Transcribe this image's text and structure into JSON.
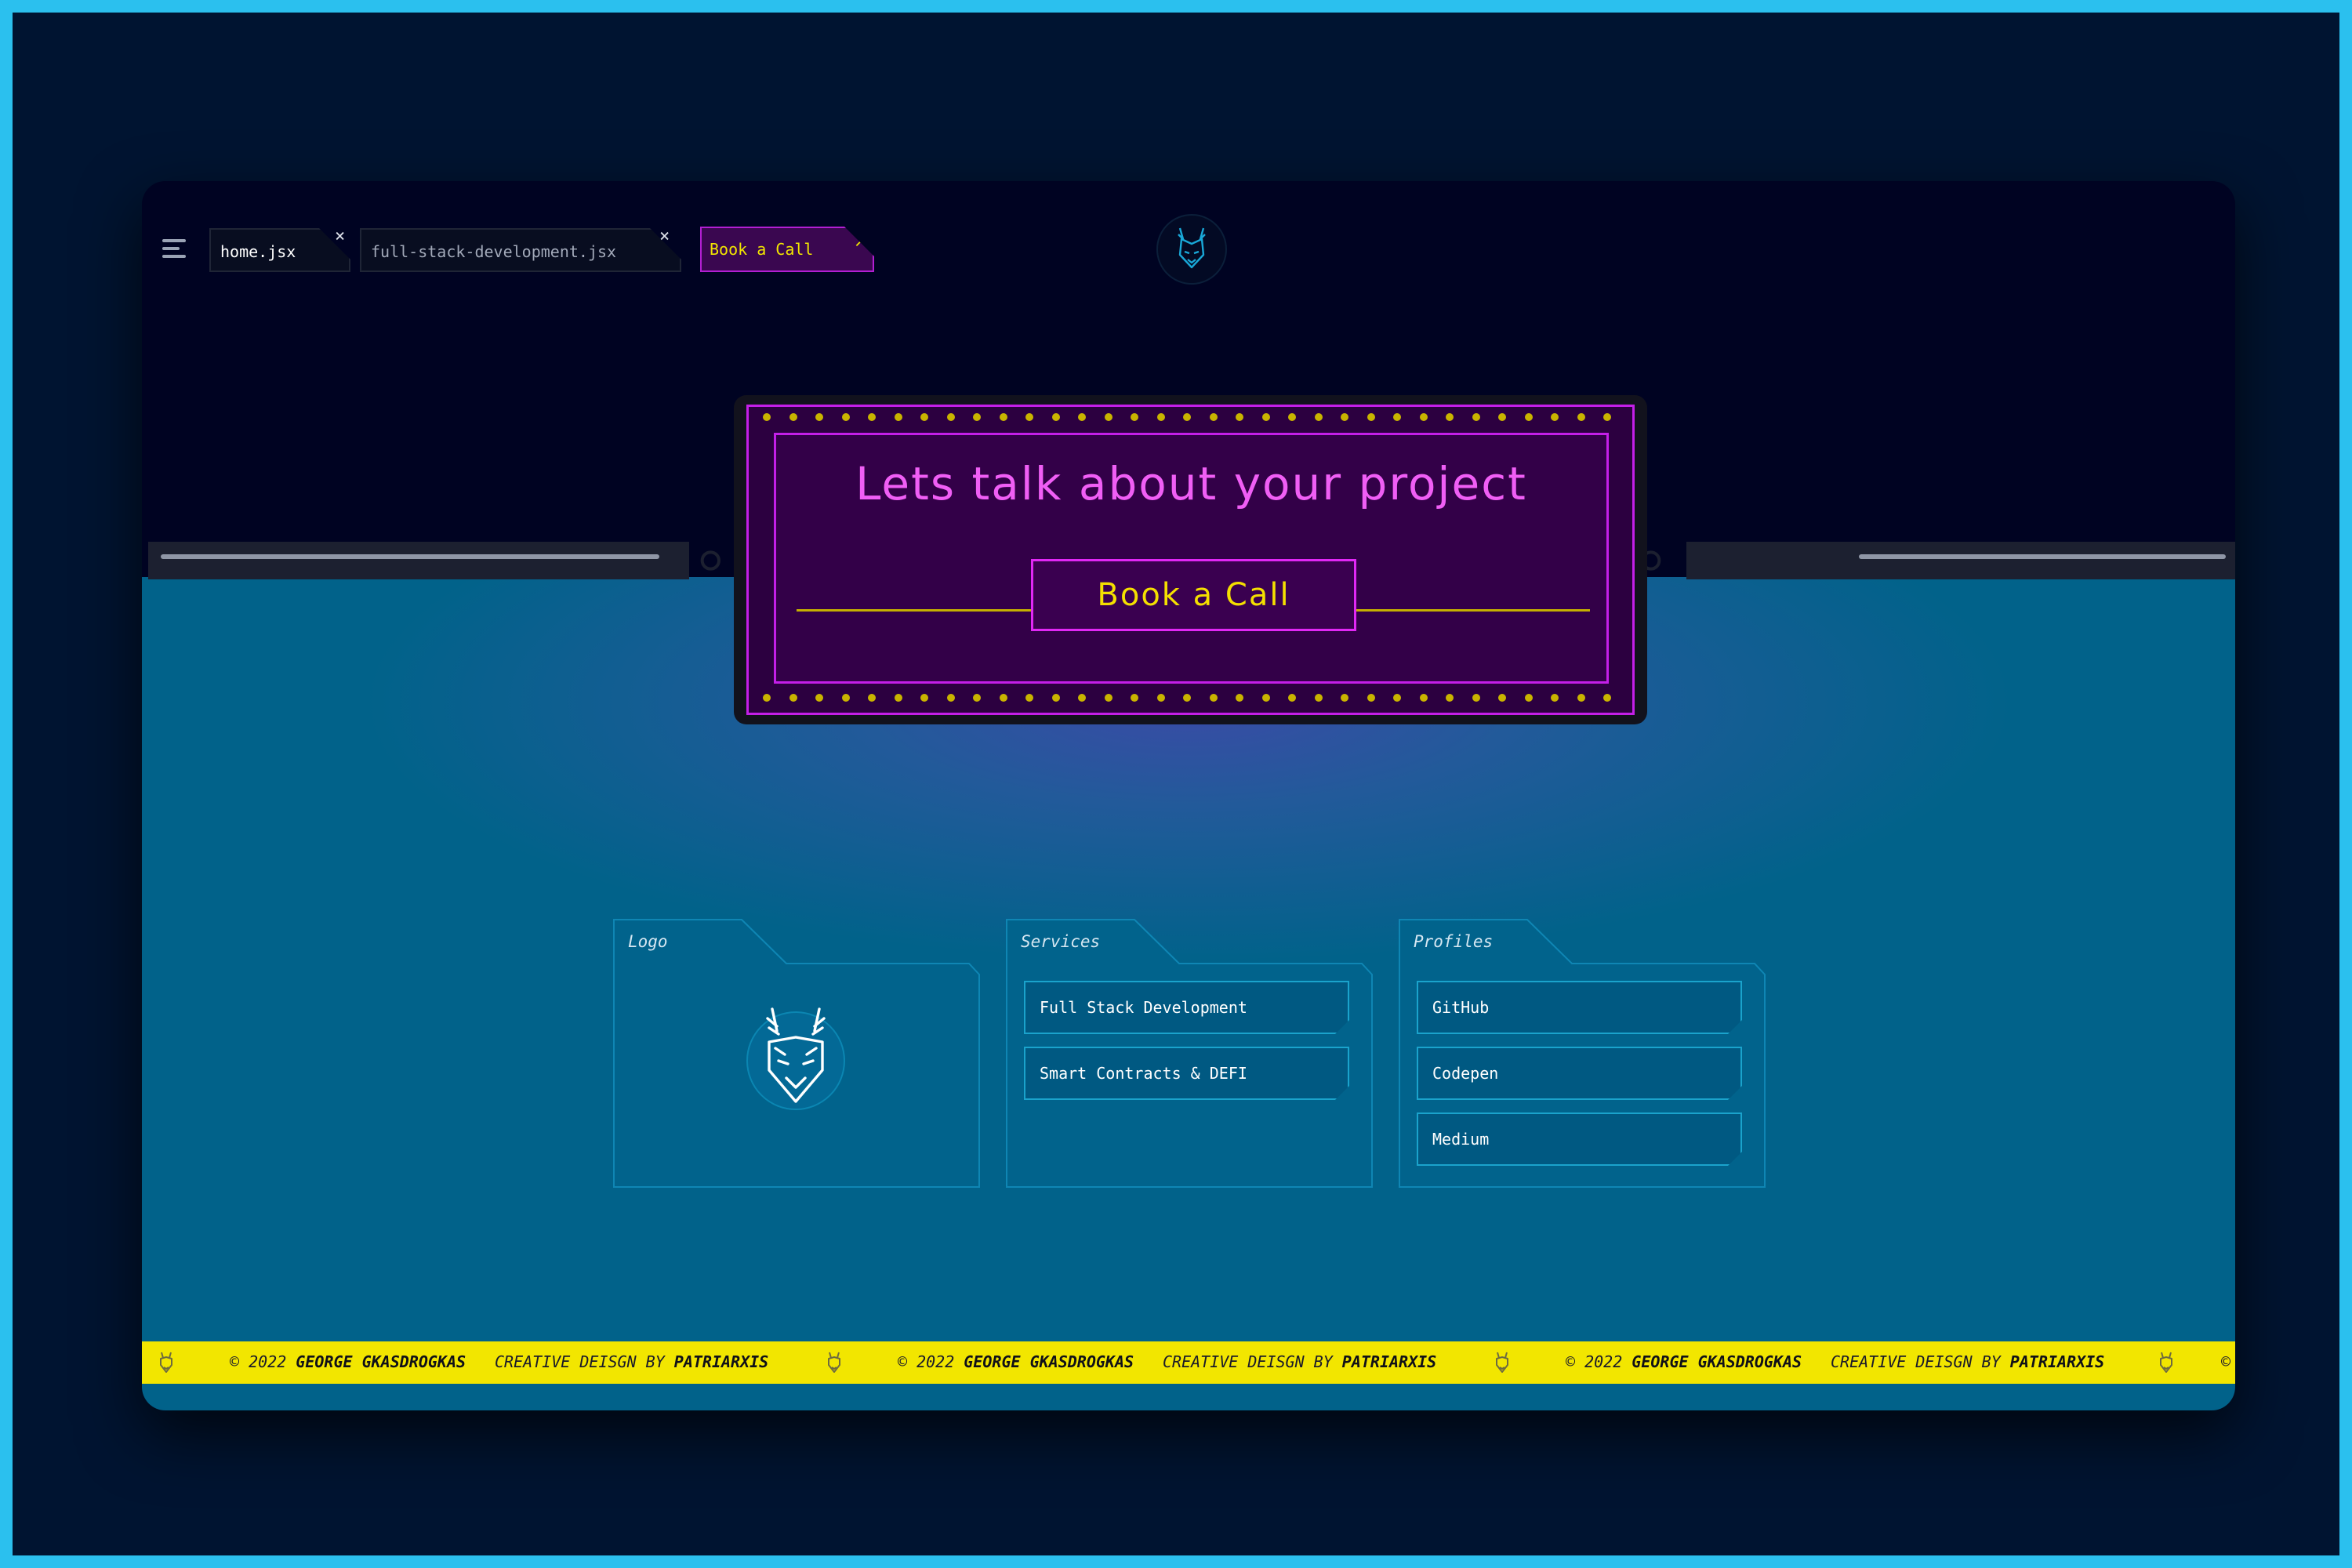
{
  "tabs": [
    {
      "label": "home.jsx",
      "close": "×"
    },
    {
      "label": "full-stack-development.jsx",
      "close": "×"
    }
  ],
  "header": {
    "call_chip_label": "Book a Call",
    "call_chip_icon": "arrow-up-right-icon",
    "menu_icon": "menu-icon",
    "logo_icon": "fox-logo-icon"
  },
  "billboard": {
    "title": "Lets talk about your project",
    "button_label": "Book a Call"
  },
  "folders": {
    "logo": {
      "title": "Logo"
    },
    "services": {
      "title": "Services",
      "items": [
        "Full Stack Development",
        "Smart Contracts & DEFI"
      ]
    },
    "profiles": {
      "title": "Profiles",
      "items": [
        "GitHub",
        "Codepen",
        "Medium"
      ]
    }
  },
  "footer": {
    "copyright_prefix": "© 2022",
    "author": "GEORGE GKASDROGKAS",
    "credit_prefix": "CREATIVE DEISGN BY",
    "designer": "PATRIARXIS",
    "trailing_fragment": "©"
  },
  "colors": {
    "frame_border": "#2bc0ee",
    "page_bg": "#001431",
    "accent_magenta": "#c41fe8",
    "accent_yellow": "#f2e600",
    "title_pink": "#f05ef5",
    "teal_bg": "#01628a"
  }
}
